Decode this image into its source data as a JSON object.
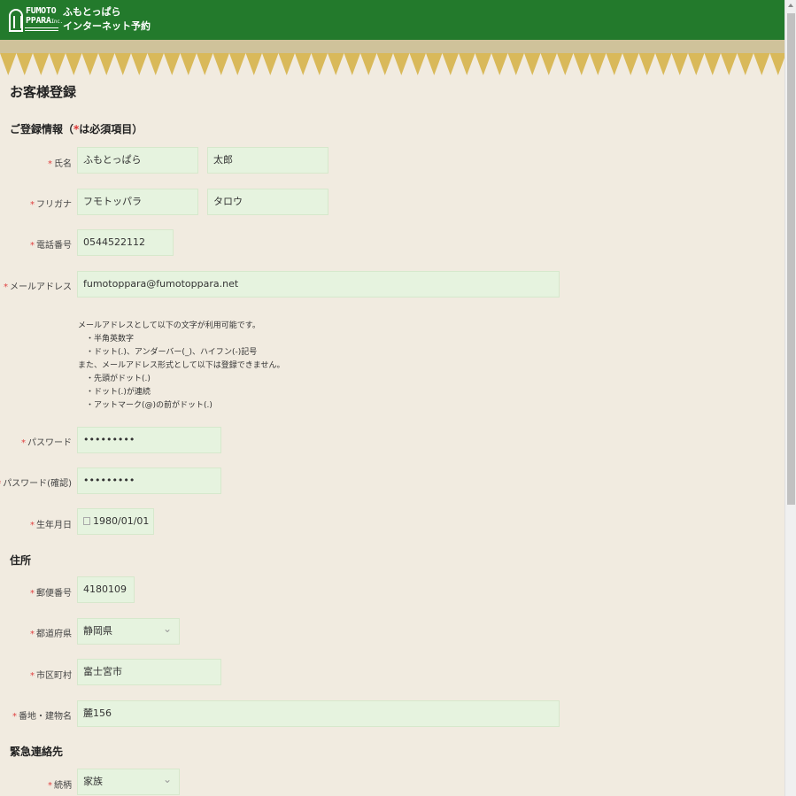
{
  "header": {
    "logo_line1": "FUMOTO",
    "logo_line2": "PPARA",
    "logo_inc": "Inc.",
    "brand_line1": "ふもとっぱら",
    "brand_line2": "インターネット予約",
    "bg_color": "#237a2c"
  },
  "page_title": "お客様登録",
  "registration": {
    "section_title_prefix": "ご登録情報（",
    "section_title_star": "*",
    "section_title_suffix": "は必須項目）",
    "name_label": "氏名",
    "last_name": "ふもとっぱら",
    "first_name": "太郎",
    "kana_label": "フリガナ",
    "last_kana": "フモトッパラ",
    "first_kana": "タロウ",
    "phone_label": "電話番号",
    "phone": "0544522112",
    "email_label": "メールアドレス",
    "email": "fumotoppara@fumotoppara.net",
    "email_note": [
      "メールアドレスとして以下の文字が利用可能です。",
      "　・半角英数字",
      "　・ドット(.)、アンダーバー(_)、ハイフン(-)記号",
      "また、メールアドレス形式として以下は登録できません。",
      "　・先頭がドット(.)",
      "　・ドット(.)が連続",
      "　・アットマーク(@)の前がドット(.)"
    ],
    "password_label": "パスワード",
    "password": "•••••••••",
    "password_confirm_label": "パスワード(確認)",
    "password_confirm": "•••••••••",
    "birthday_label": "生年月日",
    "birthday": "1980/01/01"
  },
  "address": {
    "section_title": "住所",
    "zip_label": "郵便番号",
    "zip": "4180109",
    "pref_label": "都道府県",
    "pref": "静岡県",
    "city_label": "市区町村",
    "city": "富士宮市",
    "street_label": "番地・建物名",
    "street": "麓156"
  },
  "emergency": {
    "section_title": "緊急連絡先",
    "relation_label": "続柄",
    "relation": "家族"
  },
  "required_mark": "*"
}
